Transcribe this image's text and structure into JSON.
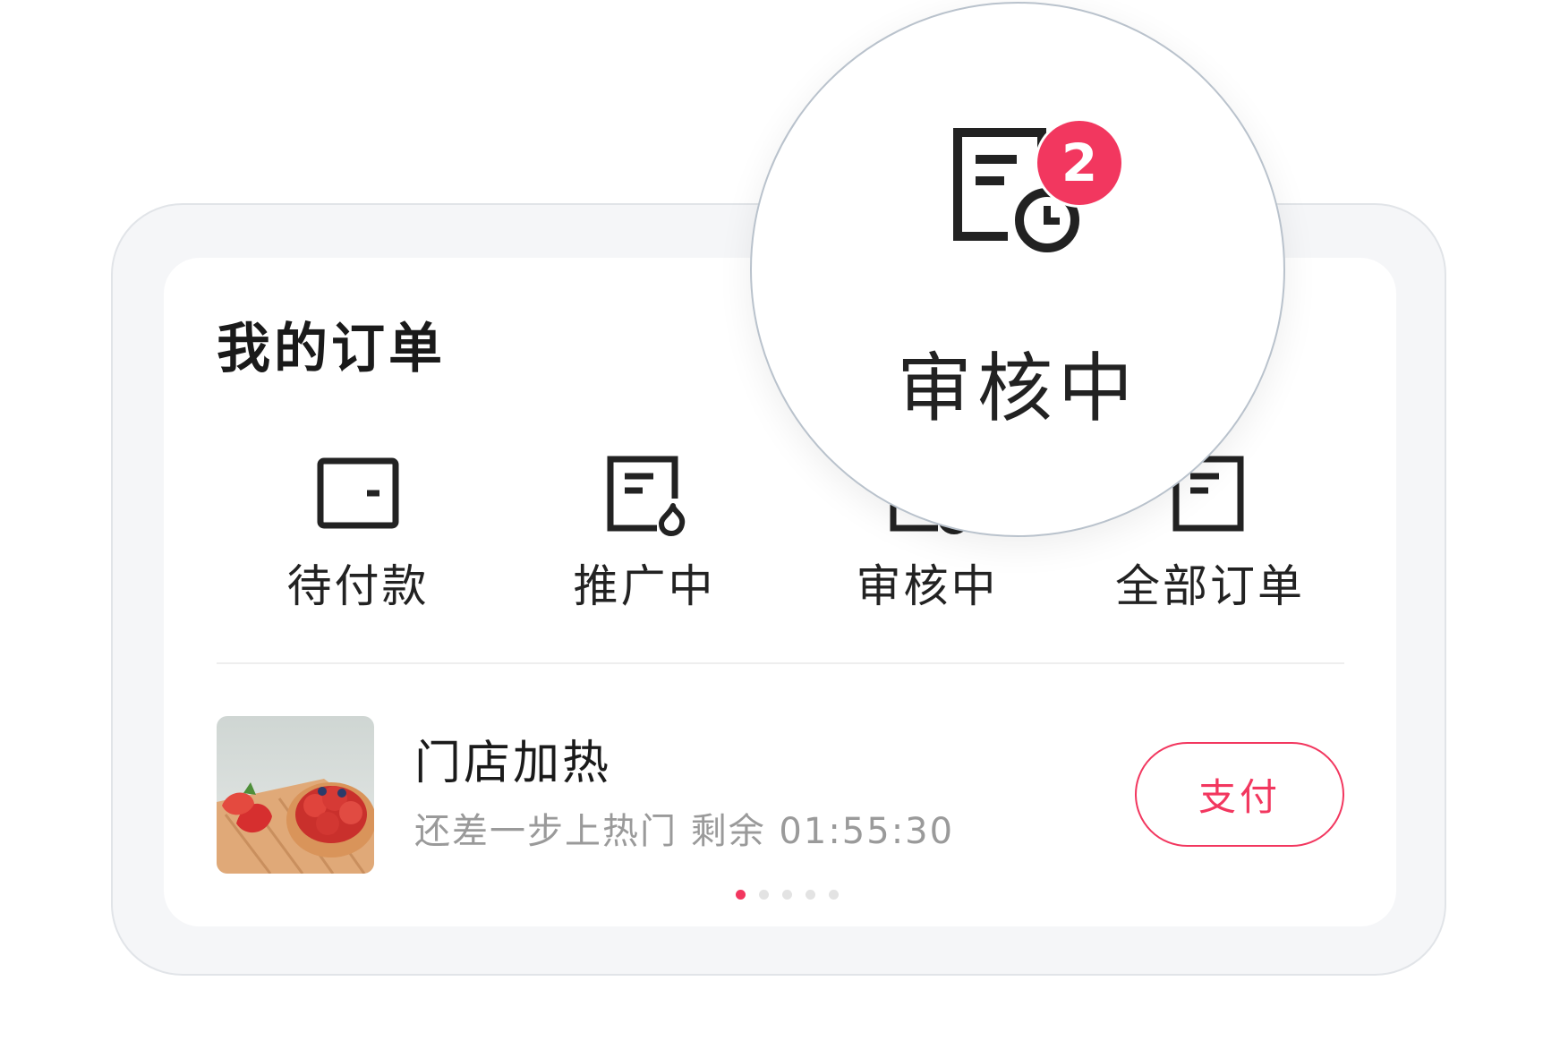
{
  "orders": {
    "title": "我的订单",
    "menu": [
      {
        "label": "待付款",
        "icon": "wallet-icon"
      },
      {
        "label": "推广中",
        "icon": "document-fire-icon"
      },
      {
        "label": "审核中",
        "icon": "document-clock-icon"
      },
      {
        "label": "全部订单",
        "icon": "document-icon"
      }
    ],
    "current_order": {
      "title": "门店加热",
      "subtitle": "还差一步上热门 剩余 01:55:30",
      "pay_label": "支付",
      "thumbnail": "strawberry-tart-image"
    },
    "pagination": {
      "total": 5,
      "active": 1
    }
  },
  "magnifier": {
    "label": "审核中",
    "badge_count": "2",
    "icon": "document-clock-icon"
  },
  "colors": {
    "accent": "#f2375f",
    "text": "#222222",
    "muted": "#9a9a9a",
    "card_bg": "#f5f6f8"
  }
}
